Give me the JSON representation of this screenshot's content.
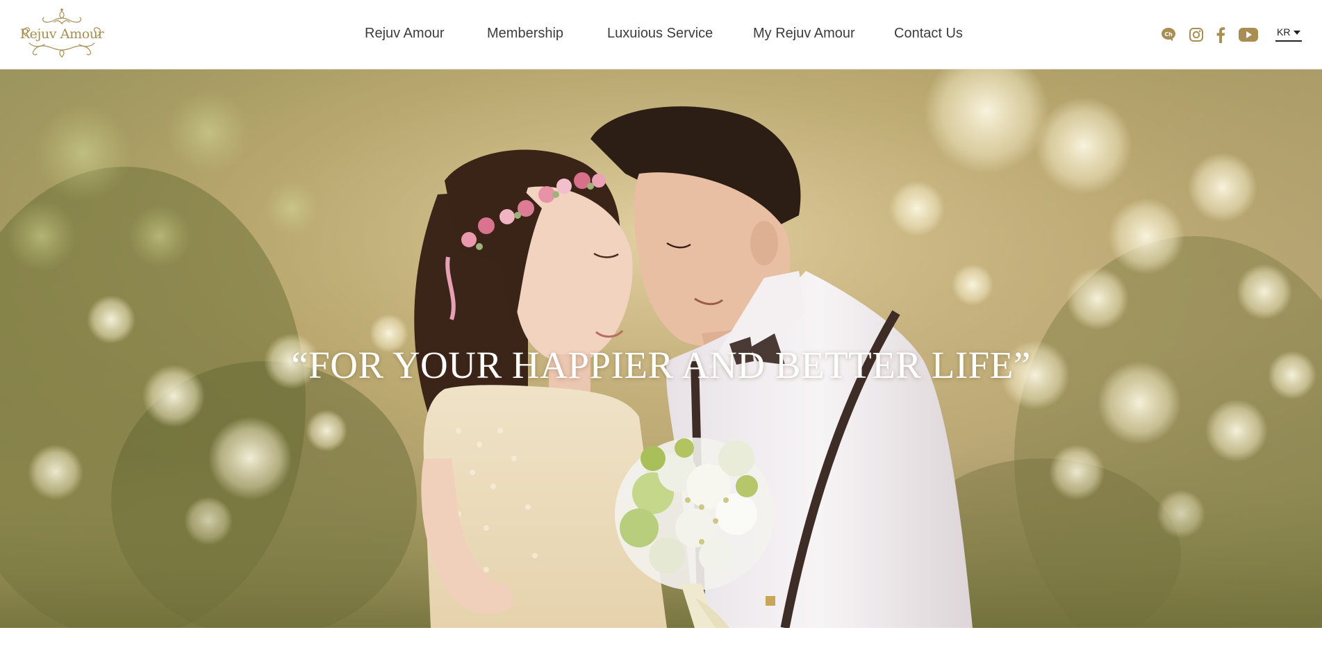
{
  "brand": {
    "logo_text": "Rejuv Amour",
    "color": "#a88e52"
  },
  "nav": {
    "items": [
      {
        "label": "Rejuv Amour"
      },
      {
        "label": "Membership"
      },
      {
        "label": "Luxuious Service"
      },
      {
        "label": "My Rejuv Amour"
      },
      {
        "label": "Contact Us"
      }
    ]
  },
  "social": {
    "icons": [
      "kakao-channel-icon",
      "instagram-icon",
      "facebook-icon",
      "youtube-icon"
    ],
    "kakao_glyph": "Ch",
    "color": "#a88e52"
  },
  "language": {
    "selected": "KR"
  },
  "hero": {
    "slogan": "“FOR YOUR HAPPIER AND BETTER LIFE”"
  }
}
